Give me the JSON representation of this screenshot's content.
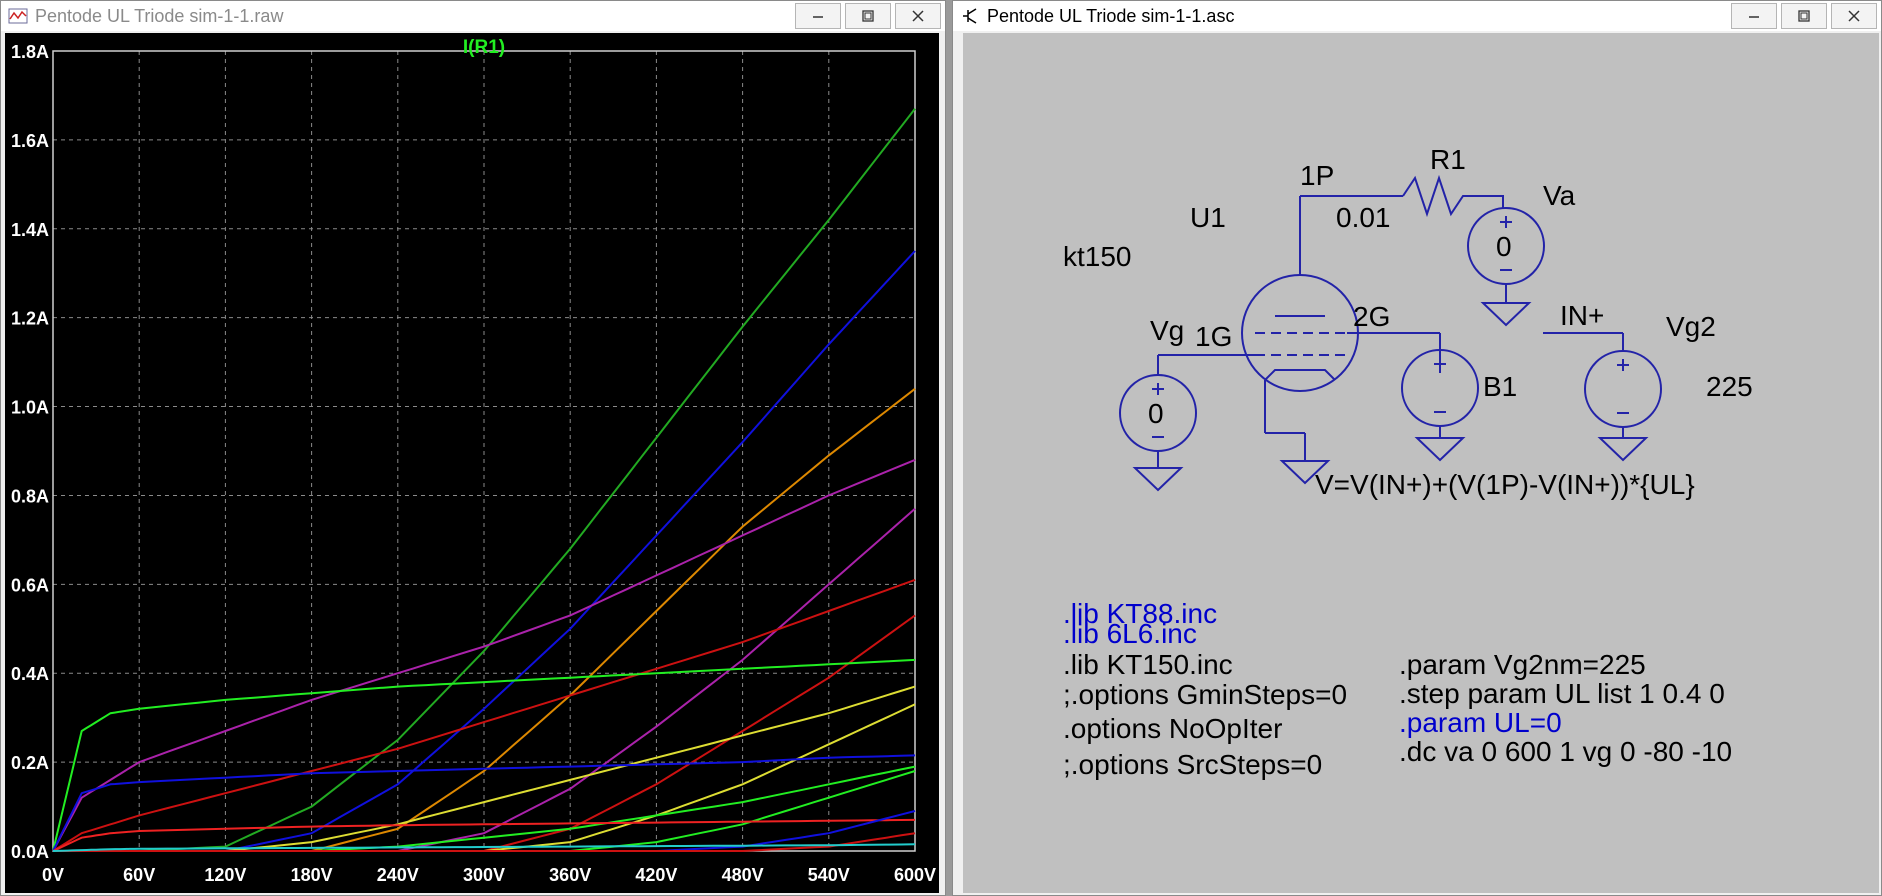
{
  "plot_window": {
    "title": "Pentode UL Triode sim-1-1.raw",
    "trace_label": "I(R1)",
    "trace_label_color": "#22ee22"
  },
  "schematic_window": {
    "title": "Pentode UL Triode sim-1-1.asc",
    "labels": {
      "r1": "R1",
      "r1_value": "0.01",
      "net_1p": "1P",
      "va": "Va",
      "va_value": "0",
      "u1": "U1",
      "model": "kt150",
      "vg": "Vg",
      "vg_value": "0",
      "net_1g": "1G",
      "net_2g": "2G",
      "b1": "B1",
      "net_in": "IN+",
      "vg2": "Vg2",
      "vg2_value": "225",
      "b1_expr": "V=V(IN+)+(V(1P)-V(IN+))*{UL}"
    },
    "directives": {
      "lib_kt88": ".lib KT88.inc",
      "lib_6l6": ".lib 6L6.inc",
      "lib_kt150": ".lib KT150.inc",
      "opt_gmin": ";.options GminSteps=0",
      "opt_noopiter": ".options NoOpIter",
      "opt_src": ";.options SrcSteps=0",
      "param_vg2": ".param Vg2nm=225",
      "step": ".step param UL list 1 0.4 0",
      "param_ul": ".param UL=0",
      "dc": ".dc va 0 600 1 vg 0 -80 -10"
    },
    "colors": {
      "wire": "#2323a8",
      "directive_active": "#0000cc",
      "background": "#c0c0c0"
    }
  },
  "window_buttons": {
    "minimize": "minimize-icon",
    "maximize": "maximize-icon",
    "close": "close-icon"
  },
  "chart_data": {
    "type": "line",
    "xlabel": "",
    "ylabel": "",
    "xlim": [
      0,
      600
    ],
    "ylim": [
      0,
      1.8
    ],
    "x_ticks": [
      0,
      60,
      120,
      180,
      240,
      300,
      360,
      420,
      480,
      540,
      600
    ],
    "x_tick_labels": [
      "0V",
      "60V",
      "120V",
      "180V",
      "240V",
      "300V",
      "360V",
      "420V",
      "480V",
      "540V",
      "600V"
    ],
    "y_ticks": [
      0,
      0.2,
      0.4,
      0.6,
      0.8,
      1.0,
      1.2,
      1.4,
      1.6,
      1.8
    ],
    "y_tick_labels": [
      "0.0A",
      "0.2A",
      "0.4A",
      "0.6A",
      "0.8A",
      "1.0A",
      "1.2A",
      "1.4A",
      "1.6A",
      "1.8A"
    ],
    "grid": true,
    "x": [
      0,
      20,
      40,
      60,
      120,
      180,
      240,
      300,
      360,
      420,
      480,
      540,
      600
    ],
    "series": [
      {
        "color": "#22aa22",
        "values": [
          0,
          0,
          0,
          0,
          0.01,
          0.1,
          0.25,
          0.45,
          0.68,
          0.93,
          1.18,
          1.42,
          1.67
        ]
      },
      {
        "color": "#1010dd",
        "values": [
          0,
          0,
          0,
          0,
          0,
          0.04,
          0.15,
          0.32,
          0.5,
          0.71,
          0.92,
          1.14,
          1.35
        ]
      },
      {
        "color": "#dd8800",
        "values": [
          0,
          0,
          0,
          0,
          0,
          0,
          0.05,
          0.18,
          0.35,
          0.54,
          0.73,
          0.89,
          1.04
        ]
      },
      {
        "color": "#aa22aa",
        "values": [
          0,
          0.12,
          0.16,
          0.2,
          0.27,
          0.34,
          0.4,
          0.46,
          0.53,
          0.62,
          0.71,
          0.8,
          0.88
        ]
      },
      {
        "color": "#aa22aa",
        "values": [
          0,
          0,
          0,
          0,
          0,
          0,
          0,
          0.04,
          0.14,
          0.28,
          0.43,
          0.6,
          0.77
        ]
      },
      {
        "color": "#cc1111",
        "values": [
          0,
          0.04,
          0.06,
          0.08,
          0.13,
          0.18,
          0.23,
          0.29,
          0.35,
          0.41,
          0.47,
          0.54,
          0.61
        ]
      },
      {
        "color": "#cc1111",
        "values": [
          0,
          0,
          0,
          0,
          0,
          0,
          0,
          0,
          0.05,
          0.15,
          0.27,
          0.39,
          0.53
        ]
      },
      {
        "color": "#22ee22",
        "values": [
          0,
          0.27,
          0.31,
          0.32,
          0.34,
          0.355,
          0.37,
          0.38,
          0.39,
          0.4,
          0.41,
          0.42,
          0.43
        ]
      },
      {
        "color": "#dddd33",
        "values": [
          0,
          0,
          0,
          0,
          0,
          0.02,
          0.06,
          0.11,
          0.16,
          0.21,
          0.26,
          0.31,
          0.37
        ]
      },
      {
        "color": "#dddd33",
        "values": [
          0,
          0,
          0,
          0,
          0,
          0,
          0,
          0,
          0.02,
          0.08,
          0.15,
          0.24,
          0.33
        ]
      },
      {
        "color": "#1010dd",
        "values": [
          0,
          0.13,
          0.15,
          0.155,
          0.165,
          0.175,
          0.18,
          0.185,
          0.19,
          0.195,
          0.2,
          0.21,
          0.215
        ]
      },
      {
        "color": "#22ee22",
        "values": [
          0,
          0,
          0,
          0,
          0,
          0,
          0.01,
          0.03,
          0.05,
          0.08,
          0.11,
          0.15,
          0.19
        ]
      },
      {
        "color": "#22ee22",
        "values": [
          0,
          0,
          0,
          0,
          0,
          0,
          0,
          0,
          0,
          0.02,
          0.06,
          0.12,
          0.18
        ]
      },
      {
        "color": "#ee2222",
        "values": [
          0,
          0.03,
          0.04,
          0.045,
          0.05,
          0.055,
          0.058,
          0.06,
          0.062,
          0.064,
          0.066,
          0.068,
          0.07
        ]
      },
      {
        "color": "#1010dd",
        "values": [
          0,
          0,
          0,
          0,
          0,
          0,
          0,
          0,
          0,
          0,
          0.01,
          0.04,
          0.09
        ]
      },
      {
        "color": "#cc1111",
        "values": [
          0,
          0,
          0,
          0,
          0,
          0,
          0,
          0,
          0,
          0,
          0,
          0.01,
          0.04
        ]
      },
      {
        "color": "#22cccc",
        "values": [
          0,
          0.002,
          0.004,
          0.005,
          0.006,
          0.007,
          0.008,
          0.009,
          0.01,
          0.011,
          0.012,
          0.013,
          0.015
        ]
      }
    ]
  }
}
